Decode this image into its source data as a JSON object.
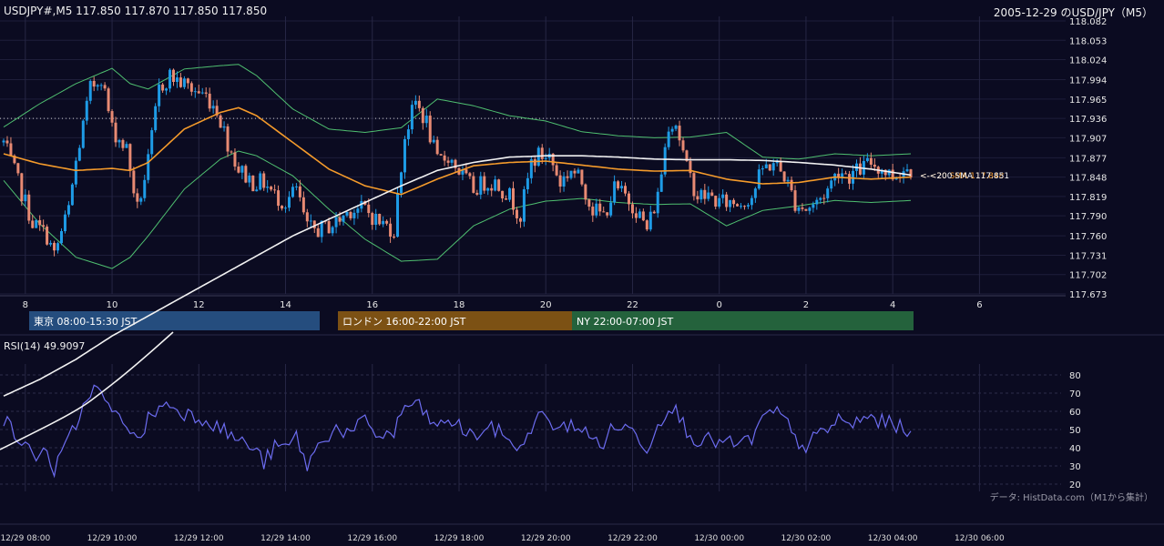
{
  "header": {
    "ohlc": "USDJPY#,M5 117.850 117.870 117.850 117.850",
    "title": "2005-12-29 のUSD/JPY（M5）"
  },
  "colors": {
    "background": "#0b0b21",
    "bull": "#1e9be6",
    "bear": "#e88a73",
    "ma20": "#f59b2b",
    "sma200": "#f2f2f2",
    "band": "#4fbf70",
    "rsi": "#6c6cf0",
    "tokyo": "#254d7e",
    "london": "#7c5114",
    "ny": "#24623c"
  },
  "chart_data": [
    {
      "type": "candlestick",
      "symbol": "USDJPY#",
      "timeframe": "M5",
      "y_ticks": [
        "118.082",
        "118.053",
        "118.024",
        "117.994",
        "117.965",
        "117.936",
        "117.907",
        "117.877",
        "117.848",
        "117.819",
        "117.790",
        "117.760",
        "117.731",
        "117.702",
        "117.673"
      ],
      "ylim": [
        117.673,
        118.082
      ],
      "x_hour_labels": [
        "8",
        "10",
        "12",
        "14",
        "16",
        "18",
        "20",
        "22",
        "0",
        "2",
        "4",
        "6"
      ],
      "reference_line": 117.936,
      "last_close_labels": {
        "sma200": "<-<200 SMA 117.851",
        "ma20": "<-<20 SMA 117.848"
      },
      "sessions": [
        {
          "label": "東京 08:00-15:30 JST",
          "color": "tokyo"
        },
        {
          "label": "ロンドン 16:00-22:00 JST",
          "color": "london"
        },
        {
          "label": "NY 22:00-07:00 JST",
          "color": "ny"
        }
      ],
      "price_path": [
        [
          0,
          117.9
        ],
        [
          4,
          117.84
        ],
        [
          8,
          117.78
        ],
        [
          12,
          117.76
        ],
        [
          14,
          117.73
        ],
        [
          18,
          117.8
        ],
        [
          20,
          117.87
        ],
        [
          24,
          117.98
        ],
        [
          27,
          118.0
        ],
        [
          30,
          117.92
        ],
        [
          34,
          117.89
        ],
        [
          37,
          117.8
        ],
        [
          40,
          117.87
        ],
        [
          43,
          117.98
        ],
        [
          46,
          118.0
        ],
        [
          49,
          117.99
        ],
        [
          52,
          117.98
        ],
        [
          56,
          117.97
        ],
        [
          59,
          117.95
        ],
        [
          62,
          117.9
        ],
        [
          65,
          117.86
        ],
        [
          69,
          117.84
        ],
        [
          72,
          117.84
        ],
        [
          75,
          117.82
        ],
        [
          78,
          117.81
        ],
        [
          81,
          117.83
        ],
        [
          84,
          117.77
        ],
        [
          88,
          117.77
        ],
        [
          92,
          117.78
        ],
        [
          96,
          117.8
        ],
        [
          100,
          117.8
        ],
        [
          104,
          117.78
        ],
        [
          108,
          117.77
        ],
        [
          111,
          117.91
        ],
        [
          114,
          117.96
        ],
        [
          117,
          117.93
        ],
        [
          120,
          117.87
        ],
        [
          123,
          117.88
        ],
        [
          127,
          117.85
        ],
        [
          130,
          117.83
        ],
        [
          133,
          117.84
        ],
        [
          136,
          117.84
        ],
        [
          140,
          117.82
        ],
        [
          143,
          117.79
        ],
        [
          146,
          117.87
        ],
        [
          148,
          117.88
        ],
        [
          151,
          117.88
        ],
        [
          154,
          117.84
        ],
        [
          157,
          117.86
        ],
        [
          160,
          117.84
        ],
        [
          163,
          117.8
        ],
        [
          166,
          117.79
        ],
        [
          169,
          117.83
        ],
        [
          172,
          117.82
        ],
        [
          175,
          117.8
        ],
        [
          178,
          117.77
        ],
        [
          181,
          117.82
        ],
        [
          184,
          117.93
        ],
        [
          186,
          117.93
        ],
        [
          189,
          117.86
        ],
        [
          192,
          117.82
        ],
        [
          195,
          117.82
        ],
        [
          198,
          117.81
        ],
        [
          201,
          117.81
        ],
        [
          204,
          117.81
        ],
        [
          207,
          117.82
        ],
        [
          210,
          117.86
        ],
        [
          213,
          117.87
        ],
        [
          216,
          117.85
        ],
        [
          219,
          117.81
        ],
        [
          222,
          117.8
        ],
        [
          225,
          117.81
        ],
        [
          228,
          117.83
        ],
        [
          231,
          117.86
        ],
        [
          234,
          117.85
        ],
        [
          237,
          117.86
        ],
        [
          240,
          117.87
        ],
        [
          243,
          117.86
        ],
        [
          246,
          117.85
        ],
        [
          249,
          117.86
        ],
        [
          251,
          117.86
        ]
      ],
      "sma200_path": [
        [
          0,
          117.52
        ],
        [
          10,
          117.545
        ],
        [
          20,
          117.575
        ],
        [
          30,
          117.61
        ],
        [
          40,
          117.64
        ],
        [
          50,
          117.67
        ],
        [
          60,
          117.7
        ],
        [
          70,
          117.73
        ],
        [
          80,
          117.76
        ],
        [
          90,
          117.785
        ],
        [
          100,
          117.81
        ],
        [
          110,
          117.835
        ],
        [
          120,
          117.858
        ],
        [
          130,
          117.87
        ],
        [
          140,
          117.878
        ],
        [
          150,
          117.88
        ],
        [
          160,
          117.88
        ],
        [
          170,
          117.878
        ],
        [
          180,
          117.875
        ],
        [
          190,
          117.874
        ],
        [
          200,
          117.874
        ],
        [
          210,
          117.873
        ],
        [
          220,
          117.87
        ],
        [
          230,
          117.866
        ],
        [
          240,
          117.86
        ],
        [
          251,
          117.851
        ]
      ],
      "ma20_path": [
        [
          0,
          117.883
        ],
        [
          10,
          117.868
        ],
        [
          20,
          117.858
        ],
        [
          30,
          117.861
        ],
        [
          35,
          117.858
        ],
        [
          40,
          117.87
        ],
        [
          50,
          117.92
        ],
        [
          60,
          117.945
        ],
        [
          65,
          117.952
        ],
        [
          70,
          117.94
        ],
        [
          80,
          117.9
        ],
        [
          90,
          117.86
        ],
        [
          100,
          117.835
        ],
        [
          110,
          117.822
        ],
        [
          120,
          117.845
        ],
        [
          130,
          117.865
        ],
        [
          140,
          117.87
        ],
        [
          150,
          117.872
        ],
        [
          160,
          117.866
        ],
        [
          170,
          117.86
        ],
        [
          180,
          117.857
        ],
        [
          190,
          117.858
        ],
        [
          200,
          117.845
        ],
        [
          210,
          117.838
        ],
        [
          220,
          117.84
        ],
        [
          230,
          117.848
        ],
        [
          240,
          117.845
        ],
        [
          251,
          117.848
        ]
      ],
      "band_width_path": [
        [
          0,
          0.04
        ],
        [
          10,
          0.09
        ],
        [
          20,
          0.13
        ],
        [
          30,
          0.15
        ],
        [
          40,
          0.11
        ],
        [
          50,
          0.09
        ],
        [
          60,
          0.07
        ],
        [
          70,
          0.06
        ],
        [
          80,
          0.05
        ],
        [
          90,
          0.06
        ],
        [
          100,
          0.08
        ],
        [
          110,
          0.1
        ],
        [
          120,
          0.12
        ],
        [
          130,
          0.09
        ],
        [
          140,
          0.07
        ],
        [
          150,
          0.06
        ],
        [
          160,
          0.05
        ],
        [
          170,
          0.05
        ],
        [
          180,
          0.05
        ],
        [
          190,
          0.05
        ],
        [
          200,
          0.07
        ],
        [
          210,
          0.04
        ],
        [
          220,
          0.035
        ],
        [
          230,
          0.035
        ],
        [
          240,
          0.035
        ],
        [
          251,
          0.035
        ]
      ]
    },
    {
      "type": "line",
      "title": "RSI(14) 49.9097",
      "y_ticks": [
        "80",
        "70",
        "60",
        "50",
        "40",
        "30",
        "20"
      ],
      "ylim": [
        16,
        86
      ],
      "x_labels": [
        "12/29 08:00",
        "12/29 10:00",
        "12/29 12:00",
        "12/29 14:00",
        "12/29 16:00",
        "12/29 18:00",
        "12/29 20:00",
        "12/29 22:00",
        "12/30 00:00",
        "12/30 02:00",
        "12/30 04:00",
        "12/30 06:00"
      ],
      "source_note": "データ: HistData.com（M1から集計）",
      "rsi_path": [
        [
          0,
          56
        ],
        [
          4,
          45
        ],
        [
          8,
          36
        ],
        [
          12,
          38
        ],
        [
          14,
          27
        ],
        [
          18,
          44
        ],
        [
          22,
          62
        ],
        [
          24,
          72
        ],
        [
          27,
          70
        ],
        [
          30,
          58
        ],
        [
          34,
          55
        ],
        [
          37,
          42
        ],
        [
          40,
          56
        ],
        [
          43,
          62
        ],
        [
          46,
          64
        ],
        [
          49,
          60
        ],
        [
          52,
          58
        ],
        [
          56,
          56
        ],
        [
          59,
          52
        ],
        [
          62,
          48
        ],
        [
          65,
          44
        ],
        [
          69,
          40
        ],
        [
          72,
          32
        ],
        [
          75,
          40
        ],
        [
          78,
          40
        ],
        [
          81,
          46
        ],
        [
          84,
          30
        ],
        [
          88,
          44
        ],
        [
          92,
          51
        ],
        [
          96,
          47
        ],
        [
          100,
          55
        ],
        [
          104,
          46
        ],
        [
          108,
          48
        ],
        [
          111,
          63
        ],
        [
          114,
          64
        ],
        [
          117,
          58
        ],
        [
          120,
          50
        ],
        [
          123,
          56
        ],
        [
          127,
          50
        ],
        [
          130,
          46
        ],
        [
          133,
          50
        ],
        [
          136,
          50
        ],
        [
          140,
          45
        ],
        [
          143,
          38
        ],
        [
          146,
          52
        ],
        [
          148,
          57
        ],
        [
          151,
          55
        ],
        [
          154,
          49
        ],
        [
          157,
          54
        ],
        [
          160,
          50
        ],
        [
          163,
          44
        ],
        [
          166,
          43
        ],
        [
          169,
          52
        ],
        [
          172,
          51
        ],
        [
          175,
          48
        ],
        [
          178,
          40
        ],
        [
          181,
          52
        ],
        [
          184,
          64
        ],
        [
          186,
          60
        ],
        [
          189,
          50
        ],
        [
          192,
          44
        ],
        [
          195,
          44
        ],
        [
          198,
          43
        ],
        [
          201,
          42
        ],
        [
          204,
          42
        ],
        [
          207,
          45
        ],
        [
          210,
          55
        ],
        [
          213,
          60
        ],
        [
          216,
          56
        ],
        [
          219,
          44
        ],
        [
          222,
          41
        ],
        [
          225,
          46
        ],
        [
          228,
          50
        ],
        [
          231,
          56
        ],
        [
          234,
          52
        ],
        [
          237,
          55
        ],
        [
          240,
          57
        ],
        [
          243,
          54
        ],
        [
          246,
          53
        ],
        [
          249,
          51
        ],
        [
          251,
          49.9
        ]
      ]
    }
  ]
}
